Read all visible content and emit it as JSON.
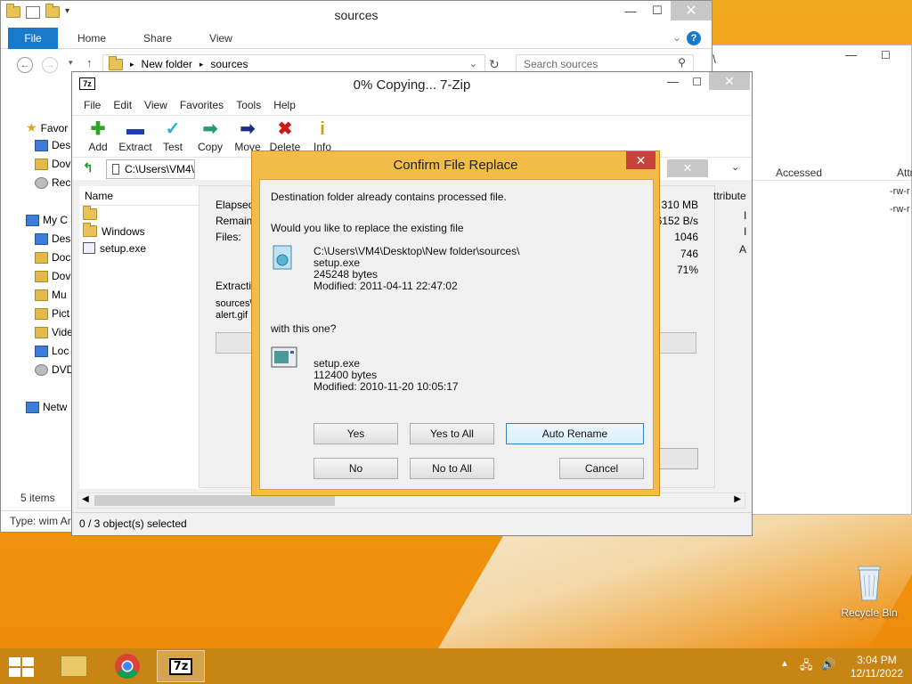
{
  "explorer": {
    "title": "sources",
    "ribbon_tabs": [
      "File",
      "Home",
      "Share",
      "View"
    ],
    "path": [
      "New folder",
      "sources"
    ],
    "search_placeholder": "Search sources",
    "nav_items": [
      "Favor",
      "Des",
      "Dov",
      "Rec",
      "My C",
      "Des",
      "Doc",
      "Dov",
      "Mu",
      "Pict",
      "Vide",
      "Loc",
      "DVD",
      "Netw"
    ],
    "item_count": "5 items",
    "type_text": "Type: wim Ar"
  },
  "background_window": {
    "title_fragment": "o\\",
    "col_accessed": "Accessed",
    "col_attr": "Attri",
    "attr_rows": [
      "-rw-r",
      "-rw-r"
    ]
  },
  "sevenzip": {
    "title": "0% Copying... 7-Zip",
    "menu": [
      "File",
      "Edit",
      "View",
      "Favorites",
      "Tools",
      "Help"
    ],
    "toolbar": [
      "Add",
      "Extract",
      "Test",
      "Copy",
      "Move",
      "Delete",
      "Info"
    ],
    "path": "C:\\Users\\VM4\\",
    "list_header": "Name",
    "list_items": [
      "",
      "Windows",
      "setup.exe"
    ],
    "progress_labels": [
      "Elapsed",
      "Remainin",
      "Files:"
    ],
    "progress_values": [
      "310 MB",
      "6152 B/s",
      "1046",
      "746",
      "71%"
    ],
    "attr_header": "ttribute",
    "extracting_label": "Extractin",
    "extract_path": "sources\\",
    "extract_file": "alert.gif",
    "status": "0 / 3 object(s) selected"
  },
  "dialog": {
    "title": "Confirm File Replace",
    "line1": "Destination folder already contains processed file.",
    "line2": "Would you like to replace the existing file",
    "existing_path": "C:\\Users\\VM4\\Desktop\\New folder\\sources\\",
    "existing_name": "setup.exe",
    "existing_size": "245248 bytes",
    "existing_modified": "Modified: 2011-04-11 22:47:02",
    "line3": "with this one?",
    "new_name": "setup.exe",
    "new_size": "112400 bytes",
    "new_modified": "Modified: 2010-11-20 10:05:17",
    "buttons": {
      "yes": "Yes",
      "yes_to_all": "Yes to All",
      "auto_rename": "Auto Rename",
      "no": "No",
      "no_to_all": "No to All",
      "cancel": "Cancel"
    }
  },
  "desktop": {
    "recycle_bin": "Recycle Bin"
  },
  "taskbar": {
    "time": "3:04 PM",
    "date": "12/11/2022",
    "sevenzip_label": "7z"
  }
}
